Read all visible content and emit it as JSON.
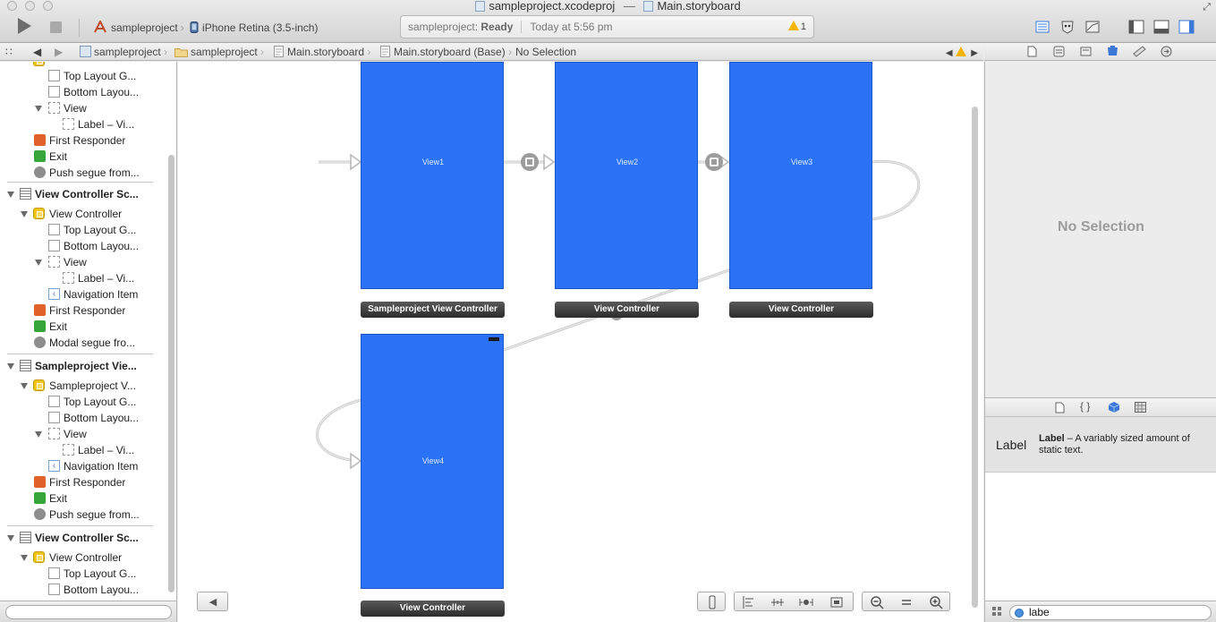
{
  "window": {
    "title_project": "sampleproject.xcodeproj",
    "title_dash": "—",
    "title_file": "Main.storyboard"
  },
  "toolbar": {
    "scheme": "sampleproject",
    "destination": "iPhone Retina (3.5-inch)",
    "activity_project": "sampleproject:",
    "activity_status": "Ready",
    "activity_time": "Today at 5:56 pm",
    "warning_count": "1"
  },
  "jumpbar": {
    "crumbs": [
      "sampleproject",
      "sampleproject",
      "Main.storyboard",
      "Main.storyboard (Base)",
      "No Selection"
    ]
  },
  "outline": {
    "rows": [
      "Top Layout G...",
      "Bottom Layou...",
      "View",
      "Label – Vi...",
      "First Responder",
      "Exit",
      "Push segue from...",
      "View Controller Sc...",
      "View Controller",
      "Top Layout G...",
      "Bottom Layou...",
      "View",
      "Label – Vi...",
      "Navigation Item",
      "First Responder",
      "Exit",
      "Modal segue fro...",
      "Sampleproject Vie...",
      "Sampleproject V...",
      "Top Layout G...",
      "Bottom Layou...",
      "View",
      "Label – Vi...",
      "Navigation Item",
      "First Responder",
      "Exit",
      "Push segue from...",
      "View Controller Sc...",
      "View Controller",
      "Top Layout G...",
      "Bottom Layou..."
    ]
  },
  "canvas": {
    "scenes": [
      {
        "view_label": "View1",
        "bar_label": "Sampleproject View Controller"
      },
      {
        "view_label": "View2",
        "bar_label": "View Controller"
      },
      {
        "view_label": "View3",
        "bar_label": "View Controller"
      },
      {
        "view_label": "View4",
        "bar_label": "View Controller"
      }
    ],
    "view_color": "#2A72F6"
  },
  "inspector": {
    "empty_text": "No Selection"
  },
  "library": {
    "item_title": "Label",
    "item_name": "Label",
    "item_desc": "– A variably sized amount of static text.",
    "filter_value": "labe"
  }
}
